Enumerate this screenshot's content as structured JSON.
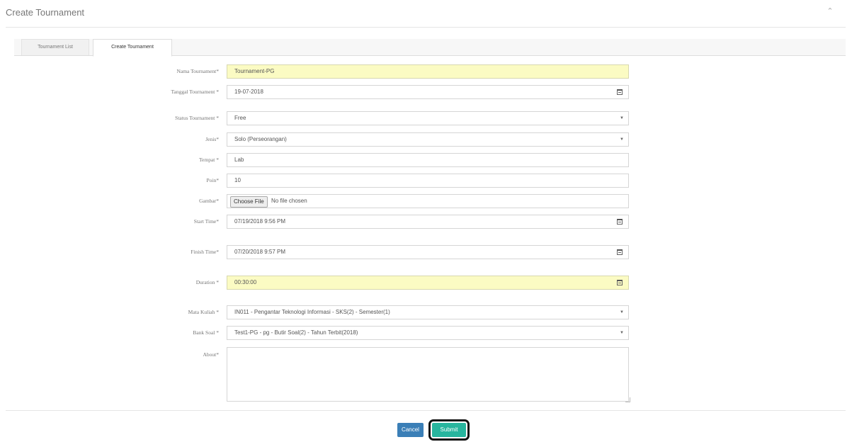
{
  "page": {
    "title": "Create Tournament"
  },
  "tabs": [
    {
      "label": "Tournament List"
    },
    {
      "label": "Create Tournament"
    }
  ],
  "form": {
    "nama_label": "Nama Tournament*",
    "nama_value": "Tournament-PG",
    "tanggal_label": "Tanggal Tournament *",
    "tanggal_value": "19-07-2018",
    "status_label": "Status Tournament *",
    "status_value": "Free",
    "jenis_label": "Jenis*",
    "jenis_value": "Solo (Perseorangan)",
    "tempat_label": "Tempat *",
    "tempat_value": "Lab",
    "poin_label": "Poin*",
    "poin_value": "10",
    "gambar_label": "Gambar*",
    "gambar_button": "Choose File",
    "gambar_status": "No file chosen",
    "start_label": "Start Time*",
    "start_value": "07/19/2018 9:56 PM",
    "finish_label": "Finish Time*",
    "finish_value": "07/20/2018 9:57 PM",
    "duration_label": "Duration *",
    "duration_value": "00:30:00",
    "matkul_label": "Mata Kuliah *",
    "matkul_value": "IN011 - Pengantar Teknologi Informasi - SKS(2) - Semester(1)",
    "banksoal_label": "Bank Soal *",
    "banksoal_value": "Test1-PG - pg - Butir Soal(2) - Tahun Terbit(2018)",
    "about_label": "About*",
    "about_value": ""
  },
  "actions": {
    "cancel": "Cancel",
    "submit": "Submit"
  },
  "colors": {
    "highlight": "#fbfbc3",
    "cancel": "#3b7fb7",
    "submit": "#28b59e"
  },
  "icons": {
    "collapse": "chevron-up-icon",
    "calendar": "calendar-icon",
    "dropdown": "caret-down-icon"
  }
}
